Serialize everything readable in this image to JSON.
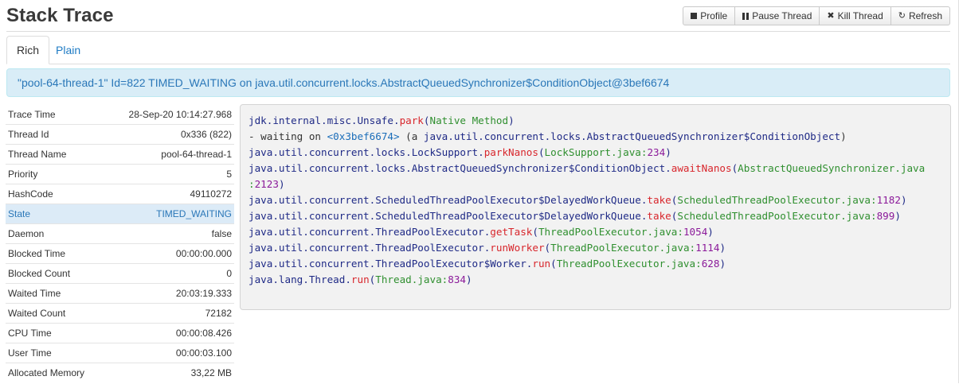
{
  "header": {
    "title": "Stack Trace"
  },
  "toolbar": {
    "profile_label": "Profile",
    "pause_label": "Pause Thread",
    "kill_label": "Kill Thread",
    "refresh_label": "Refresh",
    "icons": [
      "stop-icon",
      "pause-icon",
      "close-icon",
      "refresh-icon"
    ]
  },
  "tabs": [
    {
      "label": "Rich",
      "active": true
    },
    {
      "label": "Plain",
      "active": false
    }
  ],
  "summary": "\"pool-64-thread-1\" Id=822 TIMED_WAITING on java.util.concurrent.locks.AbstractQueuedSynchronizer$ConditionObject@3bef6674",
  "properties": [
    {
      "label": "Trace Time",
      "value": "28-Sep-20 10:14:27.968"
    },
    {
      "label": "Thread Id",
      "value": "0x336 (822)"
    },
    {
      "label": "Thread Name",
      "value": "pool-64-thread-1"
    },
    {
      "label": "Priority",
      "value": "5"
    },
    {
      "label": "HashCode",
      "value": "49110272"
    },
    {
      "label": "State",
      "value": "TIMED_WAITING"
    },
    {
      "label": "Daemon",
      "value": "false"
    },
    {
      "label": "Blocked Time",
      "value": "00:00:00.000"
    },
    {
      "label": "Blocked Count",
      "value": "0"
    },
    {
      "label": "Waited Time",
      "value": "20:03:19.333"
    },
    {
      "label": "Waited Count",
      "value": "72182"
    },
    {
      "label": "CPU Time",
      "value": "00:00:08.426"
    },
    {
      "label": "User Time",
      "value": "00:00:03.100"
    },
    {
      "label": "Allocated Memory",
      "value": "33,22 MB"
    }
  ],
  "trace": [
    {
      "cls": "jdk.internal.misc.Unsafe.",
      "method": "park",
      "file": "Native Method",
      "line": ""
    },
    {
      "waiting_prefix": "- waiting on ",
      "address": "<0x3bef6674>",
      "paren_open": " (a ",
      "waiting_class": "java.util.concurrent.locks.AbstractQueuedSynchronizer$ConditionObject",
      "paren_close": ")"
    },
    {
      "cls": "java.util.concurrent.locks.LockSupport.",
      "method": "parkNanos",
      "file": "LockSupport.java",
      "line": "234"
    },
    {
      "cls": "java.util.concurrent.locks.AbstractQueuedSynchronizer$ConditionObject.",
      "method": "awaitNanos",
      "file": "AbstractQueuedSynchronizer.java",
      "line": "2123"
    },
    {
      "cls": "java.util.concurrent.ScheduledThreadPoolExecutor$DelayedWorkQueue.",
      "method": "take",
      "file": "ScheduledThreadPoolExecutor.java",
      "line": "1182"
    },
    {
      "cls": "java.util.concurrent.ScheduledThreadPoolExecutor$DelayedWorkQueue.",
      "method": "take",
      "file": "ScheduledThreadPoolExecutor.java",
      "line": "899"
    },
    {
      "cls": "java.util.concurrent.ThreadPoolExecutor.",
      "method": "getTask",
      "file": "ThreadPoolExecutor.java",
      "line": "1054"
    },
    {
      "cls": "java.util.concurrent.ThreadPoolExecutor.",
      "method": "runWorker",
      "file": "ThreadPoolExecutor.java",
      "line": "1114"
    },
    {
      "cls": "java.util.concurrent.ThreadPoolExecutor$Worker.",
      "method": "run",
      "file": "ThreadPoolExecutor.java",
      "line": "628"
    },
    {
      "cls": "java.lang.Thread.",
      "method": "run",
      "file": "Thread.java",
      "line": "834"
    }
  ],
  "colors": {
    "link": "#1e7bc4",
    "method": "#d8262c",
    "file": "#2f8f2f",
    "line_number": "#8b1a9a",
    "highlight_row": "#dcebf7"
  }
}
